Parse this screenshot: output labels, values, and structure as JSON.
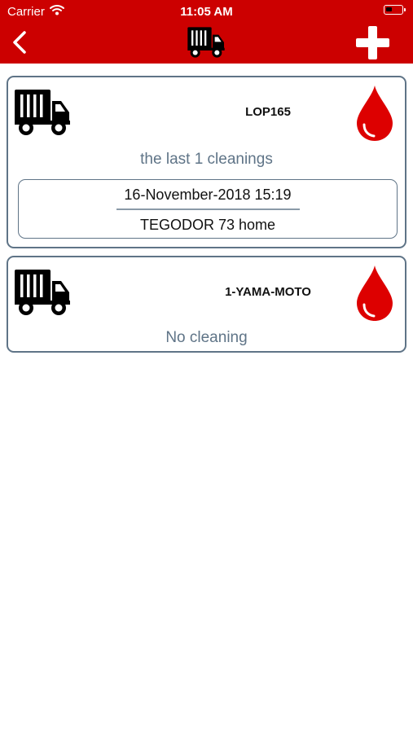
{
  "status_bar": {
    "carrier": "Carrier",
    "time": "11:05 AM"
  },
  "nav": {
    "back_icon": "chevron-left-icon",
    "title_icon": "truck-icon",
    "add_icon": "plus-icon"
  },
  "colors": {
    "brand_red": "#cc0000",
    "card_border": "#5f7487",
    "summary_text": "#5f7487",
    "drop_red": "#dd0000"
  },
  "vehicles": [
    {
      "plate": "LOP165",
      "summary": "the last 1 cleanings",
      "records": [
        {
          "date": "16-November-2018 15:19",
          "location": "TEGODOR 73 home"
        }
      ]
    },
    {
      "plate": "1-YAMA-MOTO",
      "summary": "No cleaning",
      "records": []
    }
  ]
}
